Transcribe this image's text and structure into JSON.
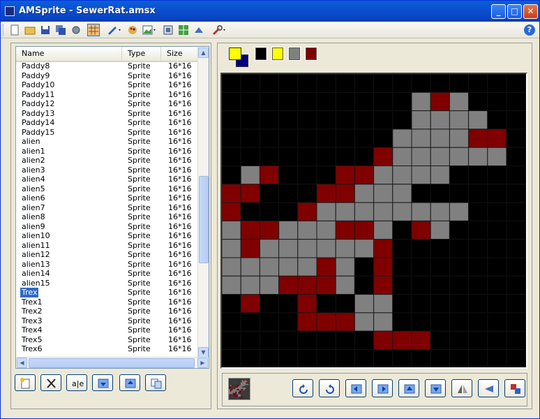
{
  "window": {
    "title": "AMSprite - SewerRat.amsx"
  },
  "titlebar": {
    "minimize": "_",
    "maximize": "□",
    "close": "✕"
  },
  "toolbar": {
    "icons": [
      "new-file-icon",
      "open-folder-icon",
      "save-icon",
      "save-all-icon",
      "gear-export-icon",
      "grid-icon",
      "pen-icon",
      "palette-icon",
      "image-icon",
      "import-icon",
      "grid-green-icon",
      "run-icon",
      "wrench-icon",
      "help-icon"
    ],
    "active_icon": "grid-icon",
    "help_label": "?"
  },
  "list": {
    "columns": [
      "Name",
      "Type",
      "Size"
    ],
    "rows": [
      {
        "name": "Paddy8",
        "type": "Sprite",
        "size": "16*16"
      },
      {
        "name": "Paddy9",
        "type": "Sprite",
        "size": "16*16"
      },
      {
        "name": "Paddy10",
        "type": "Sprite",
        "size": "16*16"
      },
      {
        "name": "Paddy11",
        "type": "Sprite",
        "size": "16*16"
      },
      {
        "name": "Paddy12",
        "type": "Sprite",
        "size": "16*16"
      },
      {
        "name": "Paddy13",
        "type": "Sprite",
        "size": "16*16"
      },
      {
        "name": "Paddy14",
        "type": "Sprite",
        "size": "16*16"
      },
      {
        "name": "Paddy15",
        "type": "Sprite",
        "size": "16*16"
      },
      {
        "name": "alien",
        "type": "Sprite",
        "size": "16*16"
      },
      {
        "name": "alien1",
        "type": "Sprite",
        "size": "16*16"
      },
      {
        "name": "alien2",
        "type": "Sprite",
        "size": "16*16"
      },
      {
        "name": "alien3",
        "type": "Sprite",
        "size": "16*16"
      },
      {
        "name": "alien4",
        "type": "Sprite",
        "size": "16*16"
      },
      {
        "name": "alien5",
        "type": "Sprite",
        "size": "16*16"
      },
      {
        "name": "alien6",
        "type": "Sprite",
        "size": "16*16"
      },
      {
        "name": "alien7",
        "type": "Sprite",
        "size": "16*16"
      },
      {
        "name": "alien8",
        "type": "Sprite",
        "size": "16*16"
      },
      {
        "name": "alien9",
        "type": "Sprite",
        "size": "16*16"
      },
      {
        "name": "alien10",
        "type": "Sprite",
        "size": "16*16"
      },
      {
        "name": "alien11",
        "type": "Sprite",
        "size": "16*16"
      },
      {
        "name": "alien12",
        "type": "Sprite",
        "size": "16*16"
      },
      {
        "name": "alien13",
        "type": "Sprite",
        "size": "16*16"
      },
      {
        "name": "alien14",
        "type": "Sprite",
        "size": "16*16"
      },
      {
        "name": "alien15",
        "type": "Sprite",
        "size": "16*16"
      },
      {
        "name": "Trex",
        "type": "Sprite",
        "size": "16*16",
        "selected": true
      },
      {
        "name": "Trex1",
        "type": "Sprite",
        "size": "16*16"
      },
      {
        "name": "Trex2",
        "type": "Sprite",
        "size": "16*16"
      },
      {
        "name": "Trex3",
        "type": "Sprite",
        "size": "16*16"
      },
      {
        "name": "Trex4",
        "type": "Sprite",
        "size": "16*16"
      },
      {
        "name": "Trex5",
        "type": "Sprite",
        "size": "16*16"
      },
      {
        "name": "Trex6",
        "type": "Sprite",
        "size": "16*16"
      }
    ]
  },
  "list_actions": [
    "new-sprite-icon",
    "delete-icon",
    "rename-icon",
    "move-down-icon",
    "move-up-icon",
    "copy-icon"
  ],
  "palette": {
    "foreground": "#ffff00",
    "background": "#000080",
    "swatches": [
      "#000000",
      "#ffff00",
      "#808080",
      "#800000"
    ]
  },
  "editor": {
    "colors": {
      "0": "#000000",
      "1": "#808080",
      "2": "#800000"
    },
    "pixels": [
      "0000000000000000",
      "0000000000121000",
      "0000000000111100",
      "0000000001111220",
      "0000000021111110",
      "0120002211110000",
      "2200022111000000",
      "2000211111111000",
      "1221112210210000",
      "1211111120000000",
      "1111121020000000",
      "1112221020000000",
      "0200200110000000",
      "0000222110000000",
      "0000000022200000",
      "0000000000000000"
    ]
  },
  "transform_buttons": [
    "rotate-ccw-icon",
    "rotate-cw-icon",
    "shift-left-icon",
    "shift-right-icon",
    "shift-up-icon",
    "shift-down-icon",
    "flip-horizontal-icon",
    "flip-vertical-icon",
    "replace-color-icon"
  ]
}
